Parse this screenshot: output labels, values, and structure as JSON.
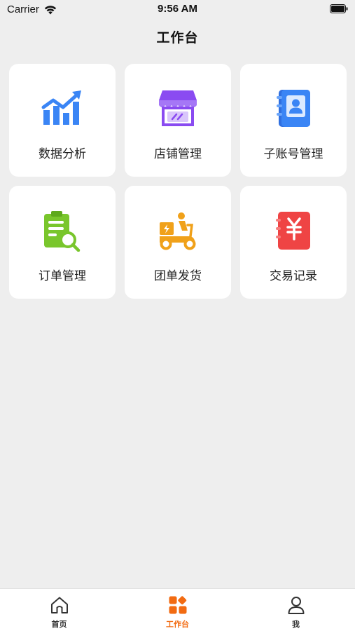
{
  "status_bar": {
    "carrier": "Carrier",
    "time": "9:56 AM",
    "wifi_icon": "wifi-icon",
    "battery_icon": "battery-icon"
  },
  "nav": {
    "title": "工作台"
  },
  "tiles": [
    {
      "label": "数据分析",
      "icon": "chart-growth-icon",
      "color": "#3a85f5"
    },
    {
      "label": "店铺管理",
      "icon": "storefront-icon",
      "color": "#8a4bf1"
    },
    {
      "label": "子账号管理",
      "icon": "contact-book-icon",
      "color": "#3a7ff0"
    },
    {
      "label": "订单管理",
      "icon": "clipboard-search-icon",
      "color": "#79c62c"
    },
    {
      "label": "团单发货",
      "icon": "delivery-scooter-icon",
      "color": "#f0a11a"
    },
    {
      "label": "交易记录",
      "icon": "yuan-ledger-icon",
      "color": "#ef4444"
    }
  ],
  "tabbar": {
    "active_color": "#f26b12",
    "items": [
      {
        "label": "首页",
        "icon": "home-icon"
      },
      {
        "label": "工作台",
        "icon": "workbench-grid-icon"
      },
      {
        "label": "我",
        "icon": "user-icon"
      }
    ]
  }
}
